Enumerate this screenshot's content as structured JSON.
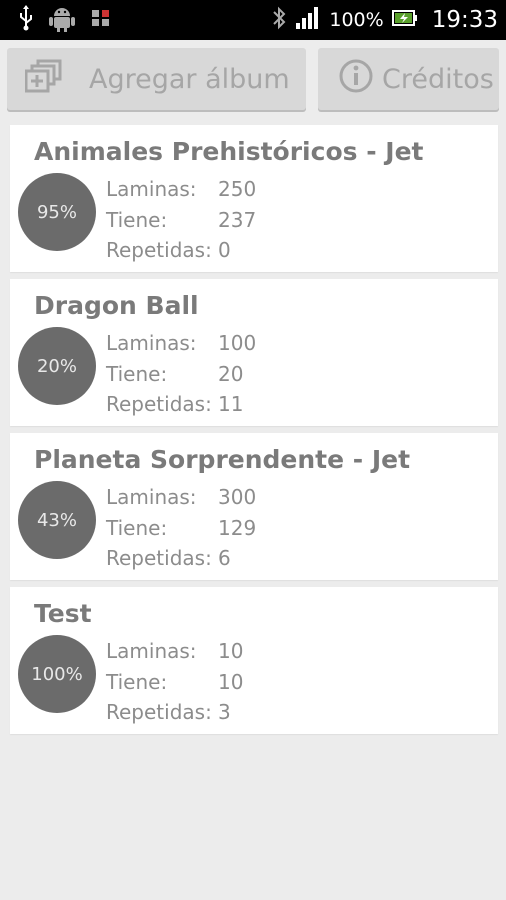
{
  "status_bar": {
    "battery": "100%",
    "time": "19:33",
    "icons": [
      "usb-icon",
      "android-debug-icon",
      "sim-icon",
      "bluetooth-icon",
      "signal-icon",
      "battery-charging-icon"
    ]
  },
  "toolbar": {
    "add_album_label": "Agregar álbum",
    "add_album_icon": "add-album-icon",
    "credits_label": "Créditos",
    "credits_icon": "info-icon"
  },
  "stat_labels": {
    "laminas": "Laminas:",
    "tiene": "Tiene:",
    "repetidas": "Repetidas:"
  },
  "albums": [
    {
      "title": "Animales Prehistóricos - Jet",
      "percent": "95%",
      "laminas": "250",
      "tiene": "237",
      "repetidas": "0"
    },
    {
      "title": "Dragon Ball",
      "percent": "20%",
      "laminas": "100",
      "tiene": "20",
      "repetidas": "11"
    },
    {
      "title": "Planeta Sorprendente - Jet",
      "percent": "43%",
      "laminas": "300",
      "tiene": "129",
      "repetidas": "6"
    },
    {
      "title": "Test",
      "percent": "100%",
      "laminas": "10",
      "tiene": "10",
      "repetidas": "3"
    }
  ]
}
